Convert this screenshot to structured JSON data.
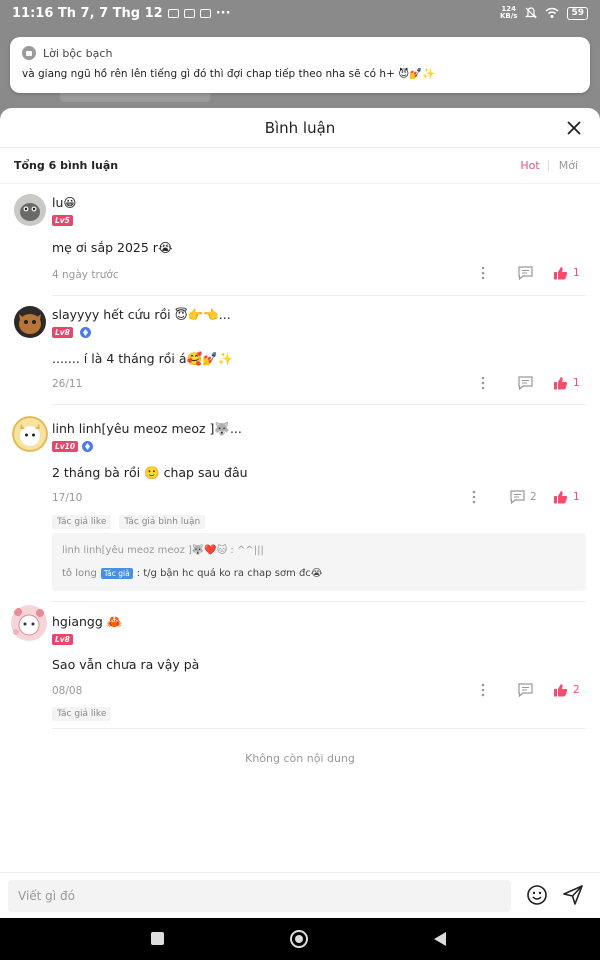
{
  "status_bar": {
    "time": "11:16 Th 7, 7 Thg 12",
    "more": "···",
    "network_speed": "124\nKB/s",
    "battery": "59"
  },
  "notification": {
    "app_name": "Lời bộc bạch",
    "message": "và giang ngũ hồ rên lên tiếng gì đó thì đợi chap tiếp theo nha sẽ có h+ 😈💅✨"
  },
  "sheet": {
    "title": "Bình luận",
    "count": "Tổng 6 bình luận",
    "sort_hot": "Hot",
    "sort_new": "Mới"
  },
  "comments": [
    {
      "name": "lu😀",
      "level": "Lv5",
      "text": "mẹ ơi sắp 2025 r😭",
      "date": "4 ngày trước",
      "likes": "1"
    },
    {
      "name": "slayyyy hết cứu rồi 😇👉👈...",
      "level": "Lv8",
      "text": "....... í là 4 tháng rồi á🥰💅✨",
      "date": "26/11",
      "likes": "1"
    },
    {
      "name": "linh linh[yêu meoz meoz ]🐺...",
      "level": "Lv10",
      "text": "2 tháng bà rồi 🙂 chap sau đâu",
      "date": "17/10",
      "replies": "2",
      "likes": "1",
      "tags": [
        "Tác giả like",
        "Tác giả bình luận"
      ],
      "reply_quote": "linh linh[yêu meoz meoz ]🐺❤️🐱 : ^^|||",
      "reply_user": "tô long",
      "reply_badge": "Tác giả",
      "reply_text": ": t/g bận hc quá ko ra chap sơm đc😭"
    },
    {
      "name": "hgiangg 🦀",
      "level": "Lv8",
      "text": "Sao vẫn chưa ra vậy pà",
      "date": "08/08",
      "likes": "2",
      "tags": [
        "Tác giả like"
      ]
    }
  ],
  "end_text": "Không còn nội dung",
  "input": {
    "placeholder": "Viết gì đó"
  }
}
